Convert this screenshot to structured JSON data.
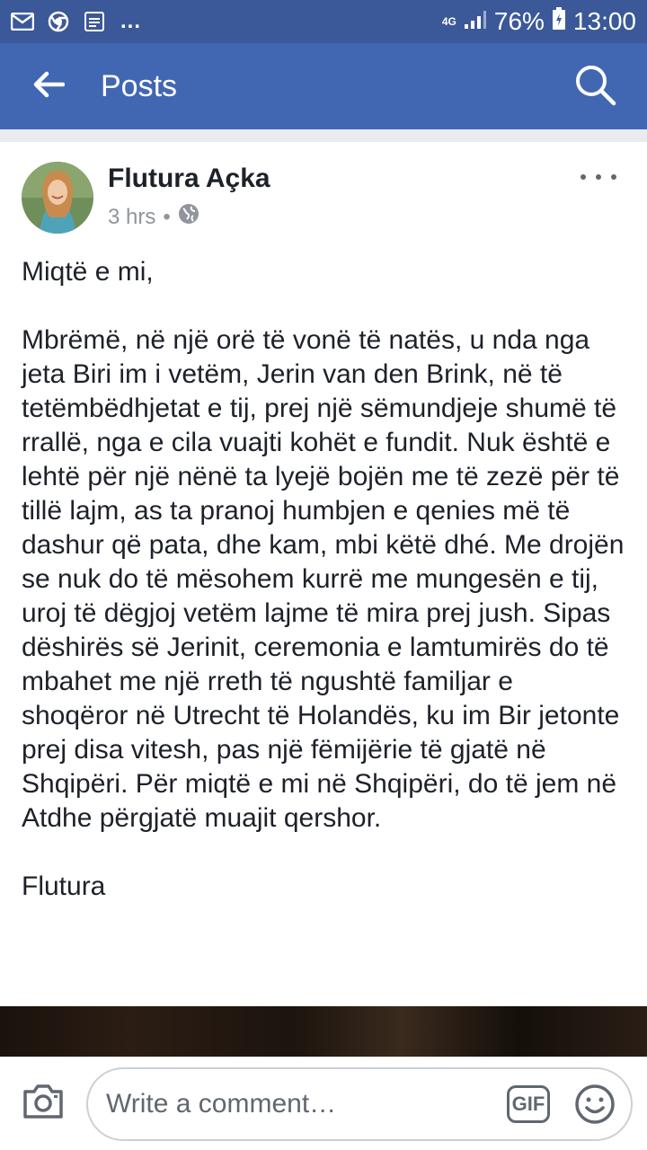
{
  "status_bar": {
    "more": "...",
    "network": "4G",
    "battery": "76%",
    "time": "13:00"
  },
  "app_bar": {
    "title": "Posts"
  },
  "post": {
    "author": "Flutura Açka",
    "time": "3 hrs",
    "separator": "•",
    "paragraphs": [
      "Miqtë e mi,",
      "Mbrëmë, në një orë të vonë të natës, u nda nga jeta Biri im i vetëm, Jerin van den Brink, në të tetëmbëdhjetat e tij, prej një sëmundjeje shumë të rrallë, nga e cila vuajti kohët e fundit. Nuk është e lehtë për një nënë ta lyejë bojën me të zezë për të tillë lajm, as ta pranoj humbjen e qenies më të dashur që pata, dhe kam, mbi këtë dhé. Me drojën se nuk do të mësohem kurrë me mungesën e tij, uroj të dëgjoj vetëm lajme të mira prej jush. Sipas dëshirës së Jerinit, ceremonia e lamtumirës do të mbahet me një rreth të ngushtë familjar e shoqëror në Utrecht të Holandës, ku im Bir jetonte prej disa vitesh, pas një fëmijërie të gjatë në Shqipëri. Për miqtë e mi në Shqipëri, do të jem në Atdhe përgjatë muajit qershor.",
      "Flutura"
    ]
  },
  "comment_bar": {
    "placeholder": "Write a comment…",
    "gif_label": "GIF"
  },
  "colors": {
    "status_bar": "#3b5998",
    "app_bar": "#4267b2",
    "text": "#1d2129",
    "meta": "#90949c"
  }
}
